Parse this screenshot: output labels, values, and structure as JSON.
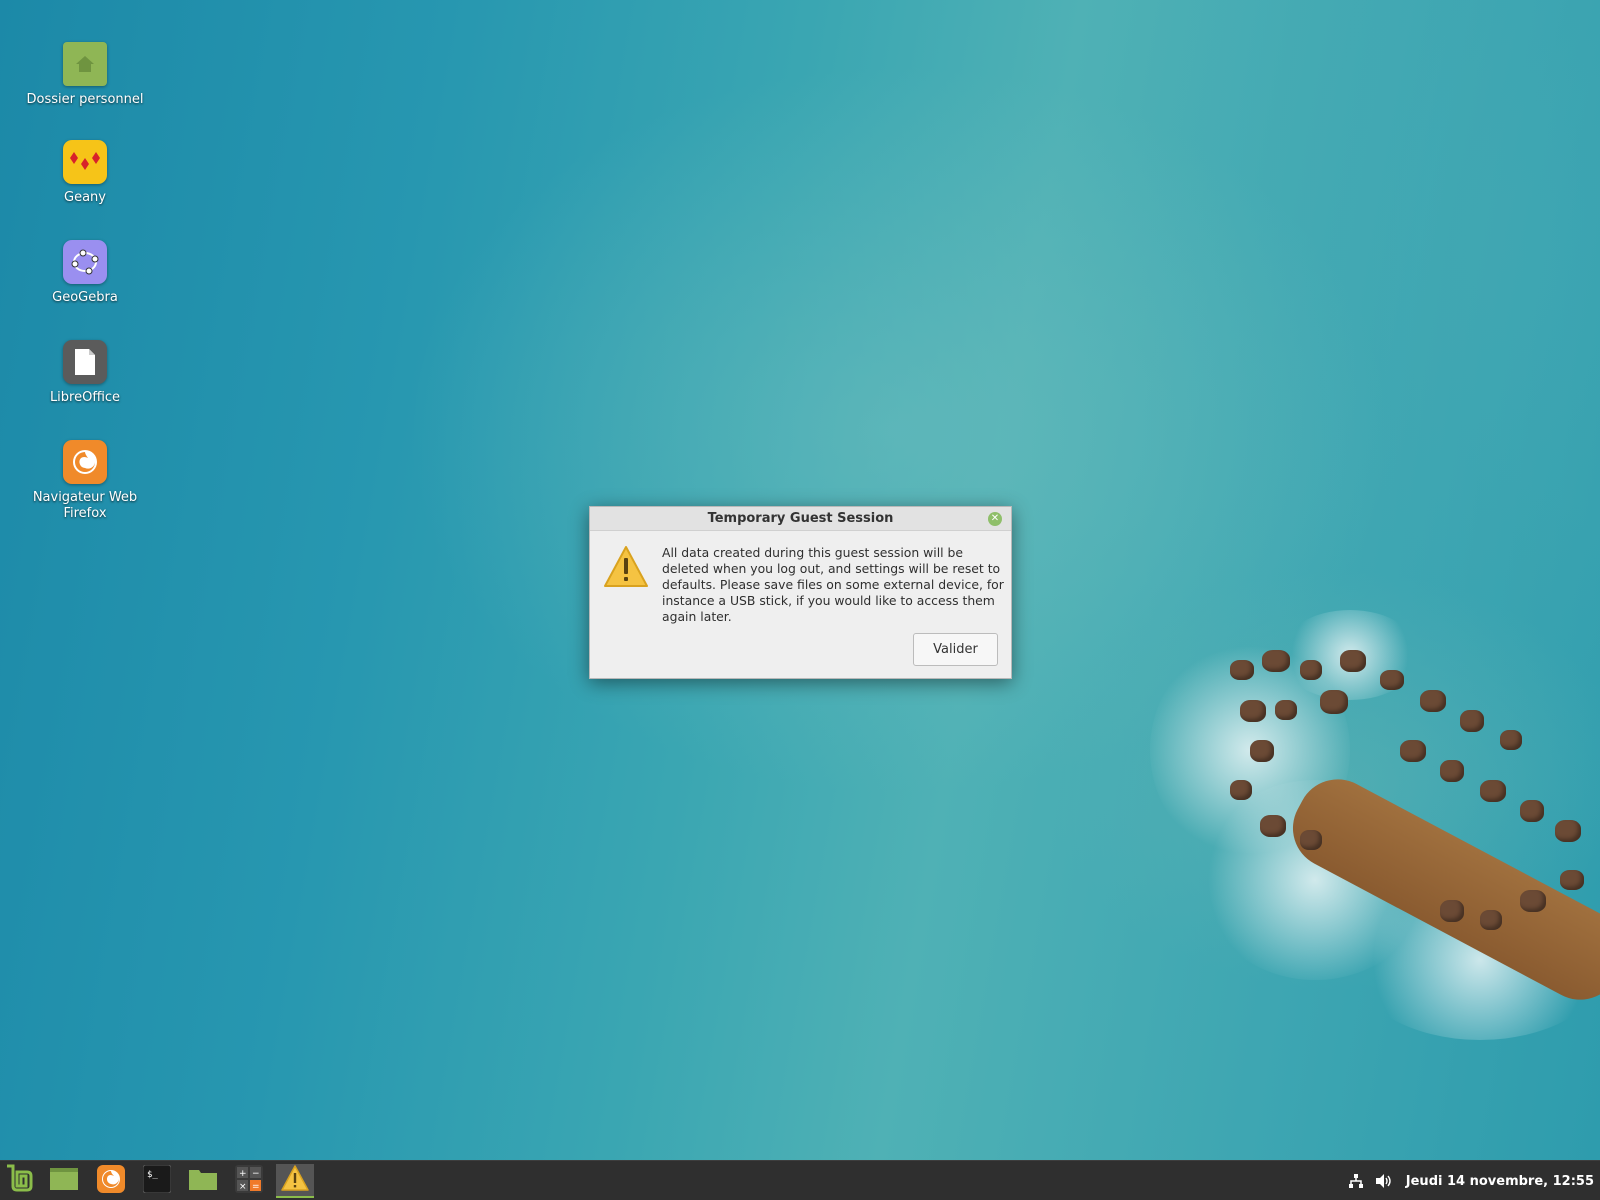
{
  "desktop": {
    "icons": [
      {
        "label": "Dossier personnel",
        "icon": "home-folder-icon"
      },
      {
        "label": "Geany",
        "icon": "geany-icon"
      },
      {
        "label": "GeoGebra",
        "icon": "geogebra-icon"
      },
      {
        "label": "LibreOffice",
        "icon": "libreoffice-icon"
      },
      {
        "label": "Navigateur Web Firefox",
        "icon": "firefox-icon"
      }
    ]
  },
  "dialog": {
    "title": "Temporary Guest Session",
    "message": "All data created during this guest session will be deleted when you log out, and settings will be reset to defaults. Please save files on some external device, for instance a USB stick, if you would like to access them again later.",
    "ok_label": "Valider",
    "icon": "warning-icon"
  },
  "taskbar": {
    "launchers": [
      {
        "icon": "mint-menu-icon"
      },
      {
        "icon": "show-desktop-icon"
      },
      {
        "icon": "firefox-icon"
      },
      {
        "icon": "terminal-icon"
      },
      {
        "icon": "files-icon"
      },
      {
        "icon": "calculator-icon"
      },
      {
        "icon": "warning-icon",
        "active": true
      }
    ],
    "tray": {
      "network_icon": "network-icon",
      "volume_icon": "volume-icon",
      "clock": "Jeudi 14 novembre, 12:55"
    }
  },
  "colors": {
    "mint_green": "#8bbd4a",
    "taskbar_bg": "#2f2f2f",
    "dialog_bg": "#efefef",
    "warning_yellow": "#f5c342"
  }
}
